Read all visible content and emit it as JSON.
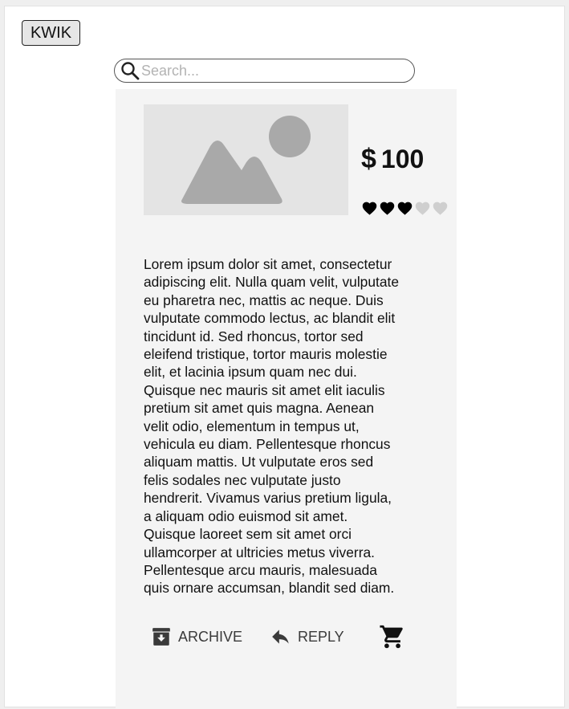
{
  "header": {
    "logo_label": "KWIK"
  },
  "search": {
    "placeholder": "Search...",
    "value": ""
  },
  "product": {
    "image_icon": "image-placeholder-icon",
    "currency_symbol": "$",
    "price": "100",
    "rating": {
      "value": 3,
      "max": 5,
      "icon": "heart-icon",
      "filled_color": "#000000",
      "empty_color": "#cfcfcf"
    },
    "description": "Lorem ipsum dolor sit amet, consectetur adipiscing elit. Nulla quam velit, vulputate eu pharetra nec, mattis ac neque. Duis vulputate commodo lectus, ac blandit elit tincidunt id. Sed rhoncus, tortor sed eleifend tristique, tortor mauris molestie elit, et lacinia ipsum quam nec dui. Quisque nec mauris sit amet elit iaculis pretium sit amet quis magna. Aenean velit odio, elementum in tempus ut, vehicula eu diam. Pellentesque rhoncus aliquam mattis. Ut vulputate eros sed felis sodales nec vulputate justo hendrerit. Vivamus varius pretium ligula, a aliquam odio euismod sit amet. Quisque laoreet sem sit amet orci ullamcorper at ultricies metus viverra. Pellentesque arcu mauris, malesuada quis ornare accumsan, blandit sed diam."
  },
  "actions": {
    "archive_label": "ARCHIVE",
    "archive_icon": "archive-icon",
    "reply_label": "REPLY",
    "reply_icon": "reply-icon",
    "cart_icon": "shopping-cart-icon"
  }
}
